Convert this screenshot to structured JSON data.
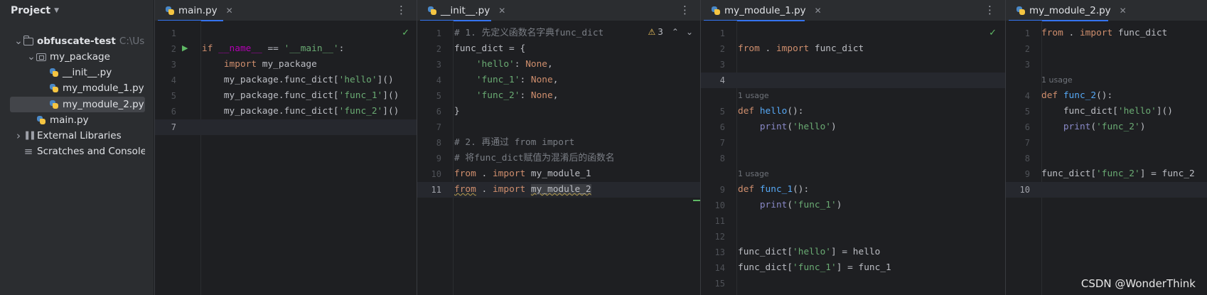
{
  "project": {
    "title": "Project",
    "tree": [
      {
        "label": "obfuscate-test",
        "hint": "C:\\Users\\",
        "type": "folder",
        "level": 0,
        "expanded": true
      },
      {
        "label": "my_package",
        "type": "package",
        "level": 1,
        "expanded": true
      },
      {
        "label": "__init__.py",
        "type": "python",
        "level": 2
      },
      {
        "label": "my_module_1.py",
        "type": "python",
        "level": 2
      },
      {
        "label": "my_module_2.py",
        "type": "python",
        "level": 2,
        "selected": true
      },
      {
        "label": "main.py",
        "type": "python",
        "level": 1
      },
      {
        "label": "External Libraries",
        "type": "library",
        "level": 0,
        "expanded": false
      },
      {
        "label": "Scratches and Consoles",
        "type": "scratches",
        "level": 0
      }
    ]
  },
  "editors": [
    {
      "tab": "main.py",
      "current_line": 7,
      "check": true,
      "lines": [
        {
          "n": 1,
          "parts": []
        },
        {
          "n": 2,
          "run_icon": true,
          "parts": [
            [
              "kw",
              "if "
            ],
            [
              "dunder",
              "__name__"
            ],
            [
              "",
              " == "
            ],
            [
              "str",
              "'__main__'"
            ],
            [
              "",
              ":"
            ]
          ]
        },
        {
          "n": 3,
          "parts": [
            [
              "",
              "    "
            ],
            [
              "kw",
              "import "
            ],
            [
              "",
              "my_package"
            ]
          ]
        },
        {
          "n": 4,
          "parts": [
            [
              "",
              "    my_package.func_dict["
            ],
            [
              "str",
              "'hello'"
            ],
            [
              "",
              "]()"
            ]
          ]
        },
        {
          "n": 5,
          "parts": [
            [
              "",
              "    my_package.func_dict["
            ],
            [
              "str",
              "'func_1'"
            ],
            [
              "",
              "]()"
            ]
          ]
        },
        {
          "n": 6,
          "parts": [
            [
              "",
              "    my_package.func_dict["
            ],
            [
              "str",
              "'func_2'"
            ],
            [
              "",
              "]()"
            ]
          ]
        },
        {
          "n": 7,
          "parts": []
        }
      ]
    },
    {
      "tab": "__init__.py",
      "current_line": 11,
      "warnings": "3",
      "lines": [
        {
          "n": 1,
          "parts": [
            [
              "cmt",
              "# 1. 先定义函数名字典func_dict"
            ]
          ]
        },
        {
          "n": 2,
          "parts": [
            [
              "",
              "func_dict = {"
            ]
          ]
        },
        {
          "n": 3,
          "parts": [
            [
              "",
              "    "
            ],
            [
              "str",
              "'hello'"
            ],
            [
              "",
              ": "
            ],
            [
              "kw",
              "None"
            ],
            [
              "",
              ","
            ]
          ]
        },
        {
          "n": 4,
          "parts": [
            [
              "",
              "    "
            ],
            [
              "str",
              "'func_1'"
            ],
            [
              "",
              ": "
            ],
            [
              "kw",
              "None"
            ],
            [
              "",
              ","
            ]
          ]
        },
        {
          "n": 5,
          "parts": [
            [
              "",
              "    "
            ],
            [
              "str",
              "'func_2'"
            ],
            [
              "",
              ": "
            ],
            [
              "kw",
              "None"
            ],
            [
              "",
              ","
            ]
          ]
        },
        {
          "n": 6,
          "parts": [
            [
              "",
              "}"
            ]
          ]
        },
        {
          "n": 7,
          "parts": []
        },
        {
          "n": 8,
          "parts": [
            [
              "cmt",
              "# 2. 再通过 from import"
            ]
          ]
        },
        {
          "n": 9,
          "parts": [
            [
              "cmt",
              "# 将func_dict赋值为混淆后的函数名"
            ]
          ]
        },
        {
          "n": 10,
          "parts": [
            [
              "kw",
              "from "
            ],
            [
              "",
              ". "
            ],
            [
              "kw",
              "import "
            ],
            [
              "",
              "my_module_1"
            ]
          ]
        },
        {
          "n": 11,
          "parts": [
            [
              "kw wavy",
              "from"
            ],
            [
              "",
              " . "
            ],
            [
              "kw",
              "import "
            ],
            [
              "hl wavy",
              "my_module_2"
            ]
          ]
        }
      ]
    },
    {
      "tab": "my_module_1.py",
      "current_line": 4,
      "check": true,
      "lines": [
        {
          "n": 1,
          "parts": []
        },
        {
          "n": 2,
          "parts": [
            [
              "kw",
              "from "
            ],
            [
              "",
              ". "
            ],
            [
              "kw",
              "import "
            ],
            [
              "",
              "func_dict"
            ]
          ]
        },
        {
          "n": 3,
          "parts": []
        },
        {
          "n": 4,
          "parts": []
        },
        {
          "n": 5,
          "usage": "1 usage",
          "parts": [
            [
              "kw",
              "def "
            ],
            [
              "fn",
              "hello"
            ],
            [
              "",
              "():"
            ]
          ]
        },
        {
          "n": 6,
          "parts": [
            [
              "",
              "    "
            ],
            [
              "bi",
              "print"
            ],
            [
              "",
              "("
            ],
            [
              "str",
              "'hello'"
            ],
            [
              "",
              ")"
            ]
          ]
        },
        {
          "n": 7,
          "parts": []
        },
        {
          "n": 8,
          "parts": []
        },
        {
          "n": 9,
          "usage": "1 usage",
          "parts": [
            [
              "kw",
              "def "
            ],
            [
              "fn",
              "func_1"
            ],
            [
              "",
              "():"
            ]
          ]
        },
        {
          "n": 10,
          "parts": [
            [
              "",
              "    "
            ],
            [
              "bi",
              "print"
            ],
            [
              "",
              "("
            ],
            [
              "str",
              "'func_1'"
            ],
            [
              "",
              ")"
            ]
          ]
        },
        {
          "n": 11,
          "parts": []
        },
        {
          "n": 12,
          "parts": []
        },
        {
          "n": 13,
          "parts": [
            [
              "",
              "func_dict["
            ],
            [
              "str",
              "'hello'"
            ],
            [
              "",
              "] = hello"
            ]
          ]
        },
        {
          "n": 14,
          "parts": [
            [
              "",
              "func_dict["
            ],
            [
              "str",
              "'func_1'"
            ],
            [
              "",
              "] = func_1"
            ]
          ]
        },
        {
          "n": 15,
          "parts": []
        }
      ]
    },
    {
      "tab": "my_module_2.py",
      "current_line": 10,
      "lines": [
        {
          "n": 1,
          "parts": [
            [
              "kw",
              "from "
            ],
            [
              "",
              ". "
            ],
            [
              "kw",
              "import "
            ],
            [
              "",
              "func_dict"
            ]
          ]
        },
        {
          "n": 2,
          "parts": []
        },
        {
          "n": 3,
          "parts": []
        },
        {
          "n": 4,
          "usage": "1 usage",
          "parts": [
            [
              "kw",
              "def "
            ],
            [
              "fn",
              "func_2"
            ],
            [
              "",
              "():"
            ]
          ]
        },
        {
          "n": 5,
          "parts": [
            [
              "",
              "    func_dict["
            ],
            [
              "str",
              "'hello'"
            ],
            [
              "",
              "]()"
            ]
          ]
        },
        {
          "n": 6,
          "parts": [
            [
              "",
              "    "
            ],
            [
              "bi",
              "print"
            ],
            [
              "",
              "("
            ],
            [
              "str",
              "'func_2'"
            ],
            [
              "",
              ")"
            ]
          ]
        },
        {
          "n": 7,
          "parts": []
        },
        {
          "n": 8,
          "parts": []
        },
        {
          "n": 9,
          "parts": [
            [
              "",
              "func_dict["
            ],
            [
              "str",
              "'func_2'"
            ],
            [
              "",
              "] = func_2"
            ]
          ]
        },
        {
          "n": 10,
          "parts": []
        }
      ]
    }
  ],
  "watermark": "CSDN @WonderThink"
}
